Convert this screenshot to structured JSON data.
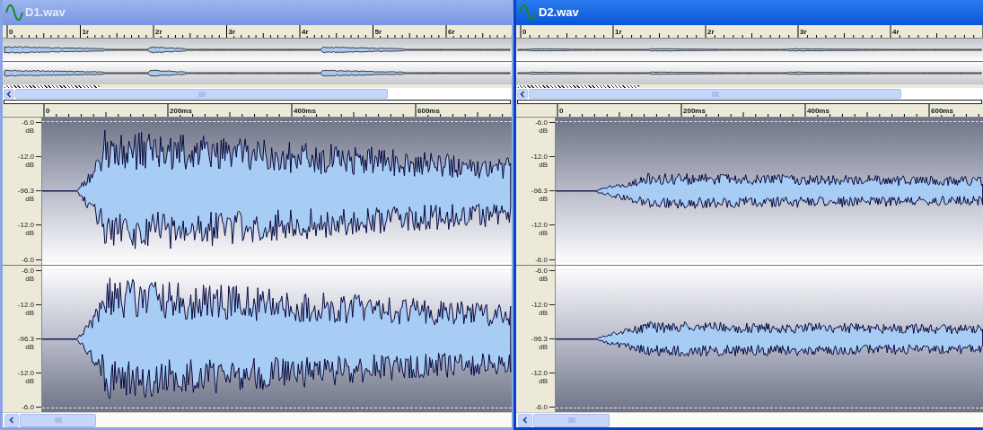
{
  "windows": [
    {
      "title": "D1.wav",
      "active": false,
      "overview_ruler": [
        "0",
        "1r",
        "2r",
        "3r",
        "4r",
        "5r",
        "6r"
      ],
      "time_ruler": [
        "0",
        "200ms",
        "400ms",
        "600ms"
      ],
      "channels": [
        {
          "scale": [
            {
              "value": "-6.0",
              "unit": "dB"
            },
            {
              "value": "-12.0",
              "unit": "dB"
            },
            {
              "value": "-96.3",
              "unit": "dB"
            },
            {
              "value": "-12.0",
              "unit": "dB"
            },
            {
              "value": "-6.0"
            }
          ]
        },
        {
          "scale": [
            {
              "value": "-6.0",
              "unit": "dB"
            },
            {
              "value": "-12.0",
              "unit": "dB"
            },
            {
              "value": "-96.3",
              "unit": "dB"
            },
            {
              "value": "-12.0",
              "unit": "dB"
            },
            {
              "value": "-6.0"
            }
          ]
        }
      ]
    },
    {
      "title": "D2.wav",
      "active": true,
      "overview_ruler": [
        "0",
        "1r",
        "2r",
        "3r",
        "4r"
      ],
      "time_ruler": [
        "0",
        "200ms",
        "400ms",
        "600ms"
      ],
      "channels": [
        {
          "scale": [
            {
              "value": "-6.0",
              "unit": "dB"
            },
            {
              "value": "-12.0",
              "unit": "dB"
            },
            {
              "value": "-96.3",
              "unit": "dB"
            },
            {
              "value": "-12.0",
              "unit": "dB"
            },
            {
              "value": "-6.0"
            }
          ]
        },
        {
          "scale": [
            {
              "value": "-6.0",
              "unit": "dB"
            },
            {
              "value": "-12.0",
              "unit": "dB"
            },
            {
              "value": "-96.3",
              "unit": "dB"
            },
            {
              "value": "-12.0",
              "unit": "dB"
            },
            {
              "value": "-6.0"
            }
          ]
        }
      ]
    }
  ]
}
